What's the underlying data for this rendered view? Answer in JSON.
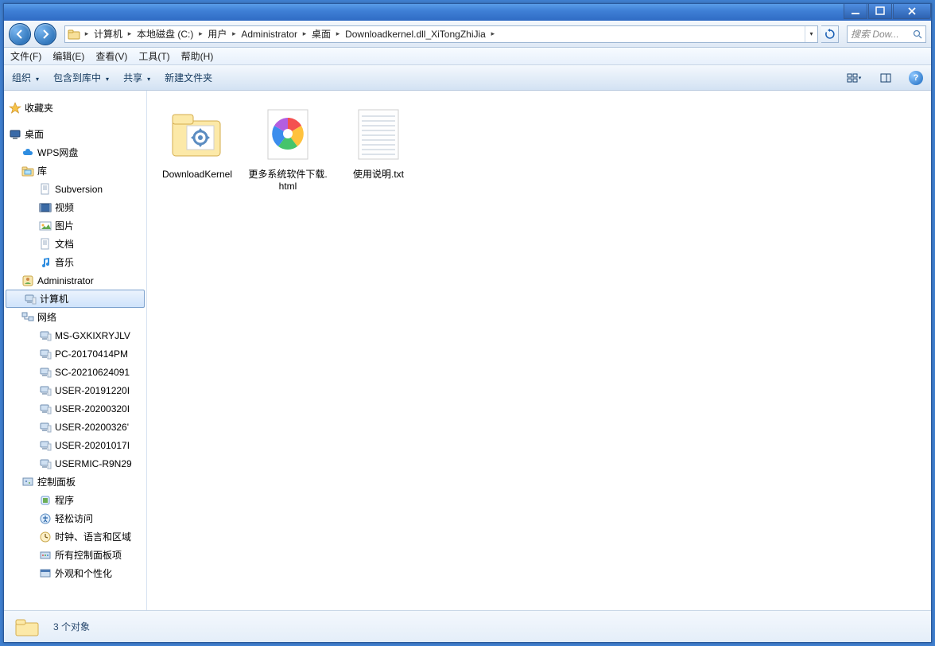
{
  "titlebar": {},
  "nav": {
    "breadcrumbs": [
      "计算机",
      "本地磁盘 (C:)",
      "用户",
      "Administrator",
      "桌面",
      "Downloadkernel.dll_XiTongZhiJia"
    ],
    "search_placeholder": "搜索 Dow..."
  },
  "menubar": [
    "文件(F)",
    "编辑(E)",
    "查看(V)",
    "工具(T)",
    "帮助(H)"
  ],
  "toolbar": {
    "organize": "组织",
    "include": "包含到库中",
    "share": "共享",
    "newfolder": "新建文件夹"
  },
  "sidebar": {
    "favorites": "收藏夹",
    "desktop": "桌面",
    "items": [
      {
        "id": "wps",
        "label": "WPS网盘",
        "icon": "cloud",
        "depth": 1
      },
      {
        "id": "lib",
        "label": "库",
        "icon": "folder",
        "depth": 1
      },
      {
        "id": "svn",
        "label": "Subversion",
        "icon": "doc",
        "depth": 2
      },
      {
        "id": "video",
        "label": "视频",
        "icon": "video",
        "depth": 2
      },
      {
        "id": "pic",
        "label": "图片",
        "icon": "pic",
        "depth": 2
      },
      {
        "id": "docs",
        "label": "文档",
        "icon": "doc",
        "depth": 2
      },
      {
        "id": "music",
        "label": "音乐",
        "icon": "music",
        "depth": 2
      },
      {
        "id": "admin",
        "label": "Administrator",
        "icon": "user",
        "depth": 1
      },
      {
        "id": "computer",
        "label": "计算机",
        "icon": "pc",
        "depth": 1,
        "selected": true
      },
      {
        "id": "network",
        "label": "网络",
        "icon": "net",
        "depth": 1
      },
      {
        "id": "n1",
        "label": "MS-GXKIXRYJLV",
        "icon": "pc",
        "depth": 2
      },
      {
        "id": "n2",
        "label": "PC-20170414PM",
        "icon": "pc",
        "depth": 2
      },
      {
        "id": "n3",
        "label": "SC-20210624091",
        "icon": "pc",
        "depth": 2
      },
      {
        "id": "n4",
        "label": "USER-20191220I",
        "icon": "pc",
        "depth": 2
      },
      {
        "id": "n5",
        "label": "USER-20200320I",
        "icon": "pc",
        "depth": 2
      },
      {
        "id": "n6",
        "label": "USER-20200326'",
        "icon": "pc",
        "depth": 2
      },
      {
        "id": "n7",
        "label": "USER-20201017I",
        "icon": "pc",
        "depth": 2
      },
      {
        "id": "n8",
        "label": "USERMIC-R9N29",
        "icon": "pc",
        "depth": 2
      },
      {
        "id": "cp",
        "label": "控制面板",
        "icon": "cp",
        "depth": 1
      },
      {
        "id": "prog",
        "label": "程序",
        "icon": "prog",
        "depth": 2
      },
      {
        "id": "ease",
        "label": "轻松访问",
        "icon": "ease",
        "depth": 2
      },
      {
        "id": "clock",
        "label": "时钟、语言和区域",
        "icon": "clock",
        "depth": 2
      },
      {
        "id": "allcp",
        "label": "所有控制面板项",
        "icon": "allcp",
        "depth": 2
      },
      {
        "id": "appear",
        "label": "外观和个性化",
        "icon": "appear",
        "depth": 2
      }
    ]
  },
  "files": [
    {
      "id": "f1",
      "name": "DownloadKernel",
      "type": "folder"
    },
    {
      "id": "f2",
      "name": "更多系统软件下载.html",
      "type": "html"
    },
    {
      "id": "f3",
      "name": "使用说明.txt",
      "type": "txt"
    }
  ],
  "status": {
    "text": "3 个对象"
  }
}
